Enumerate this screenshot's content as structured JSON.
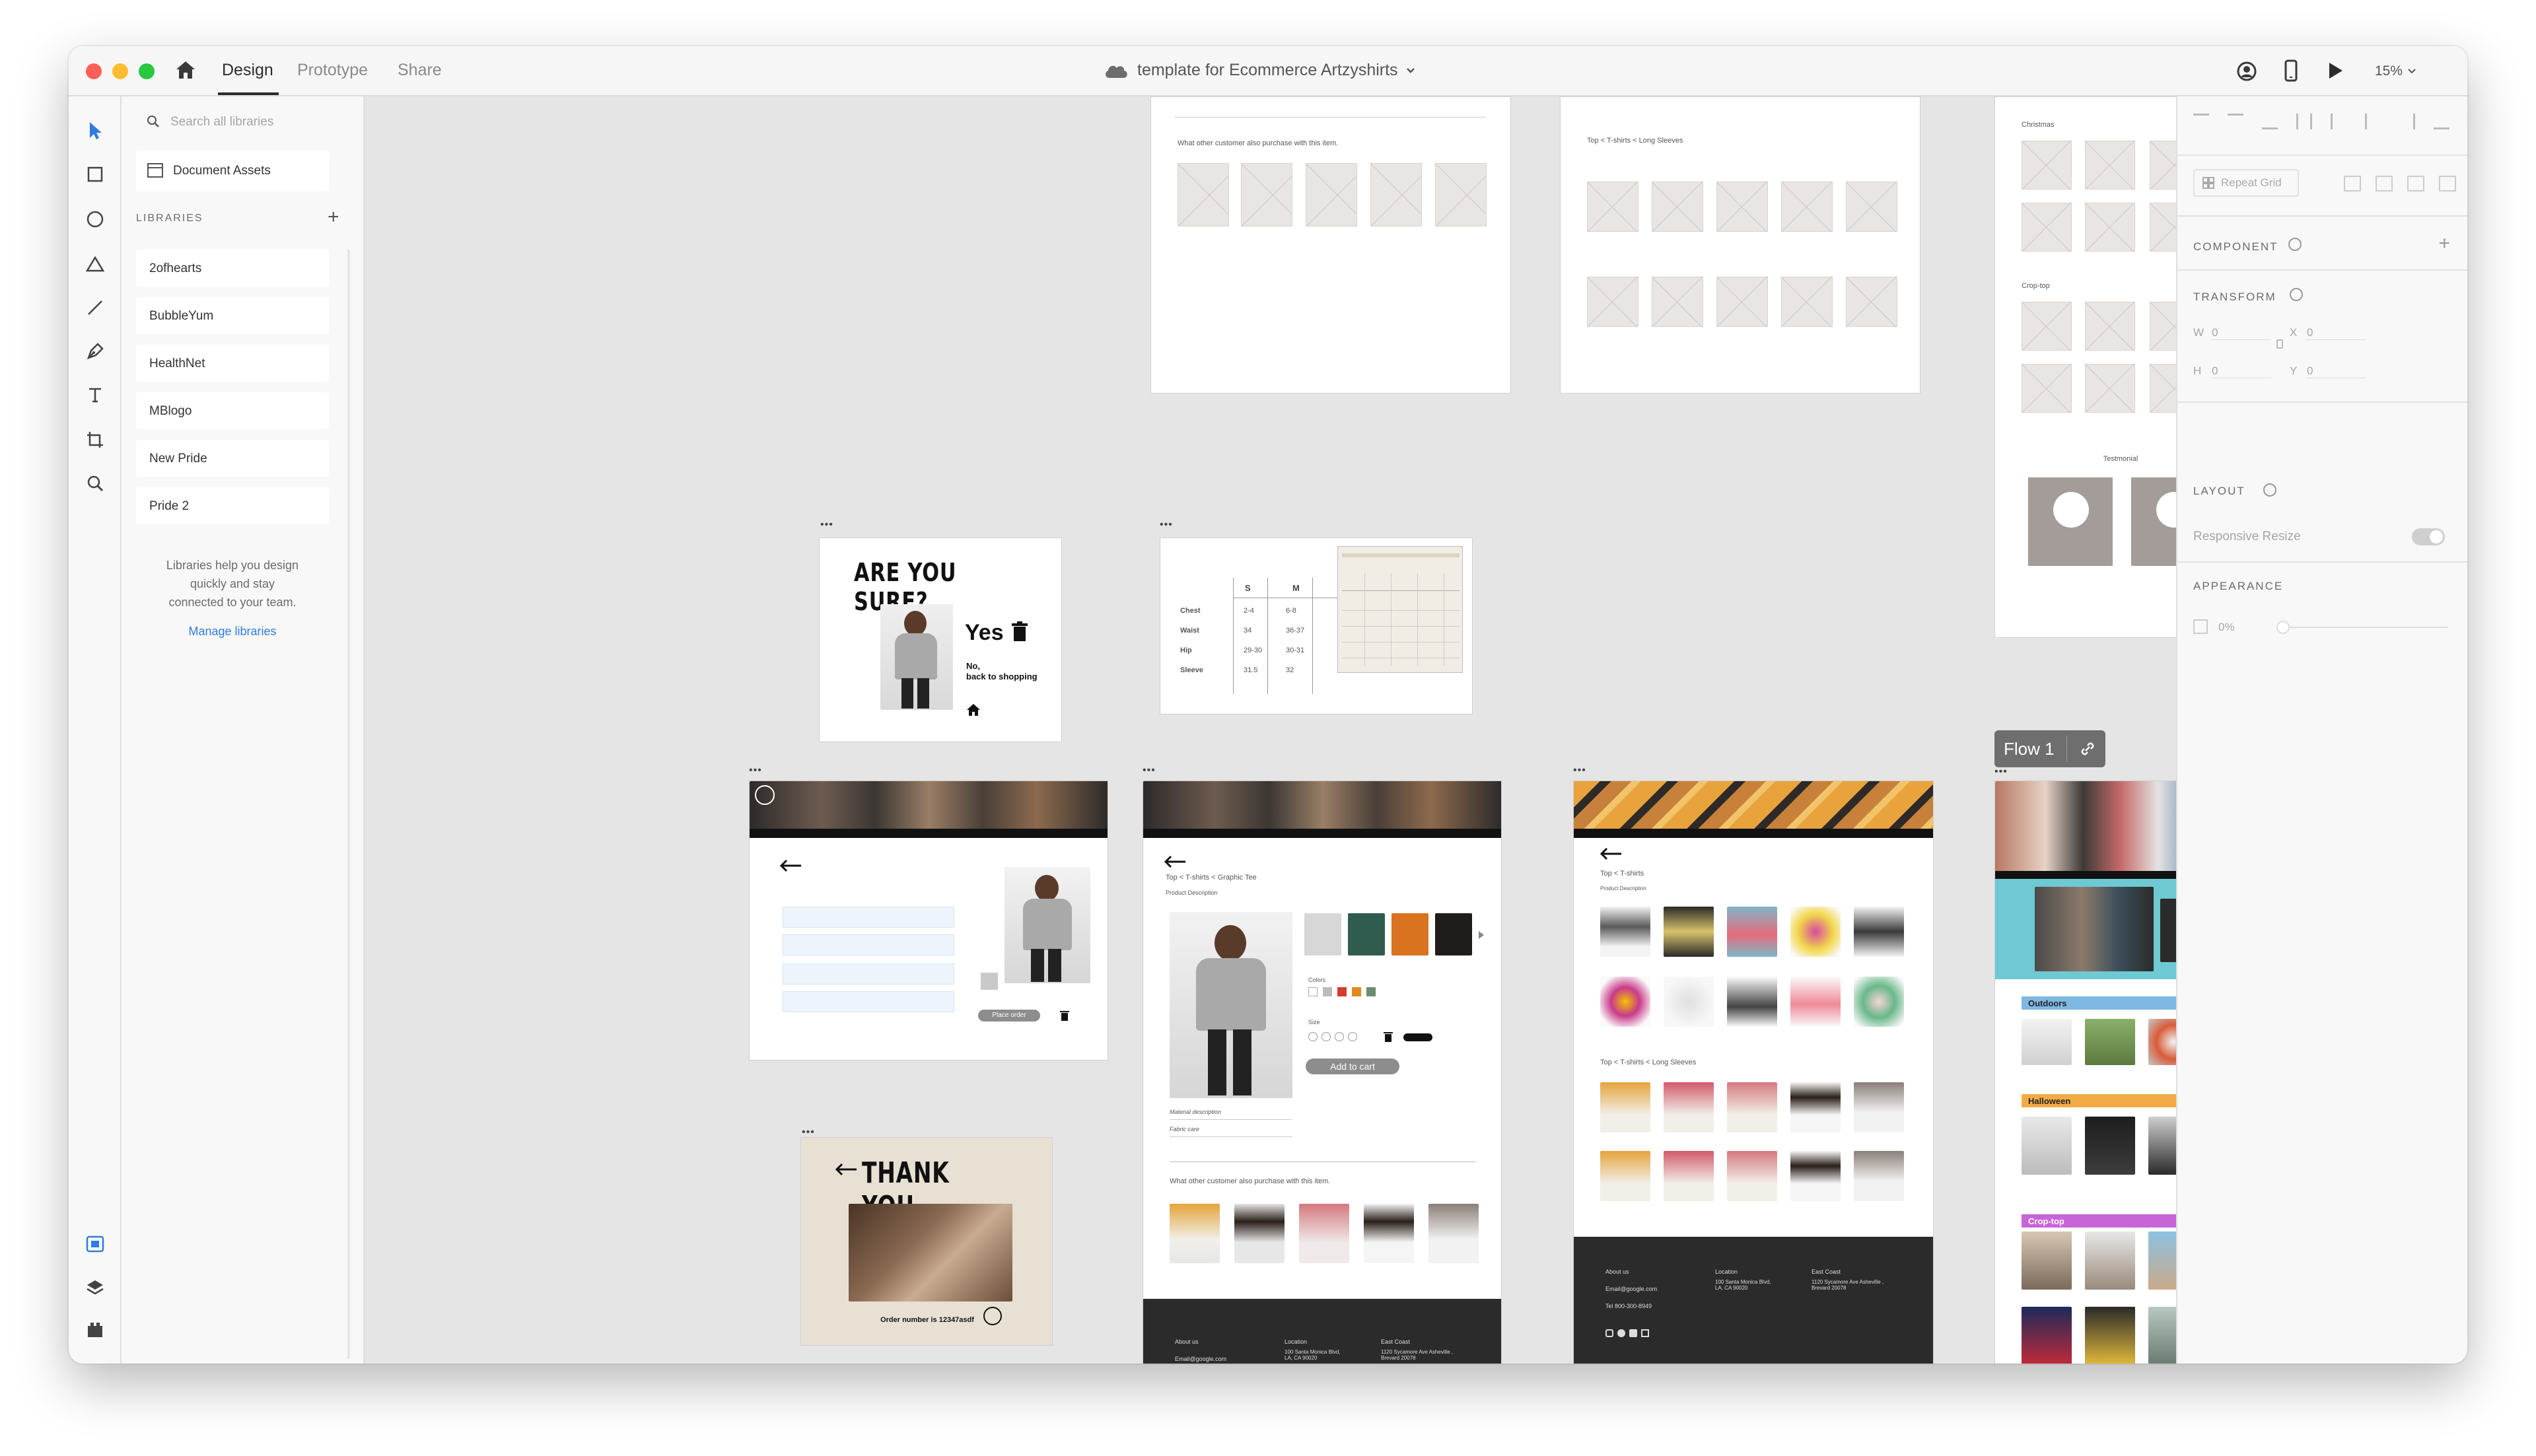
{
  "titlebar": {
    "tabs": [
      "Design",
      "Prototype",
      "Share"
    ],
    "document_title": "template for Ecommerce Artzyshirts",
    "zoom": "15%"
  },
  "libraries_panel": {
    "search_placeholder": "Search all libraries",
    "document_assets": "Document Assets",
    "libraries_heading": "LIBRARIES",
    "items": [
      "2ofhearts",
      "BubbleYum",
      "HealthNet",
      "MBlogo",
      "New Pride",
      "Pride 2"
    ],
    "help_text_1": "Libraries help you design",
    "help_text_2": "quickly and stay",
    "help_text_3": "connected to your team.",
    "manage_link": "Manage libraries"
  },
  "properties_panel": {
    "repeat_grid": "Repeat Grid",
    "component": "COMPONENT",
    "transform": "TRANSFORM",
    "w_label": "W",
    "w_value": "0",
    "x_label": "X",
    "x_value": "0",
    "h_label": "H",
    "h_value": "0",
    "y_label": "Y",
    "y_value": "0",
    "layout": "LAYOUT",
    "responsive_resize": "Responsive Resize",
    "appearance": "APPEARANCE",
    "opacity": "0%"
  },
  "canvas": {
    "flow_label": "Flow 1",
    "also_purchase": "What other customer also purchase with this item.",
    "breadcrumb_long": "Top < T-shirts < Long Sleeves",
    "breadcrumb_tshirts": "Top < T-shirts",
    "breadcrumb_graphic": "Top < T-shirts < Graphic Tee",
    "christmas": "Christmas",
    "croptop": "Crop-top",
    "testimonial": "Testmonial",
    "are_you_sure": "ARE YOU SURE?",
    "yes": "Yes",
    "no_line1": "No,",
    "no_line2": "back to shopping",
    "thank_you": "THANK YOU",
    "order_number": "Order number is 12347asdf",
    "size_s": "S",
    "size_m": "M",
    "size_rows": [
      {
        "label": "Chest",
        "s": "2-4",
        "m": "6-8"
      },
      {
        "label": "Waist",
        "s": "34",
        "m": "36-37"
      },
      {
        "label": "Hip",
        "s": "29-30",
        "m": "30-31"
      },
      {
        "label": "Sleeve",
        "s": "31.5",
        "m": "32"
      }
    ],
    "add_to_cart": "Add to cart",
    "place_order": "Place order",
    "colors": "Colors",
    "size": "Size",
    "material": "Material description",
    "fabric": "Fabric care",
    "product_desc": "Product Description",
    "outdoors": "Outdoors",
    "halloween": "Halloween",
    "croptop_tag": "Crop-top",
    "footer_about": "About us",
    "footer_email": "Email@google.com",
    "footer_tel": "Tel 800-300-8949",
    "footer_location": "Location",
    "footer_address": "100 Santa Monica Blvd, LA, CA 90020",
    "footer_east": "East Coast",
    "footer_east_addr": "1120 Sycamore Ave Asheville , Brevard 20078"
  }
}
